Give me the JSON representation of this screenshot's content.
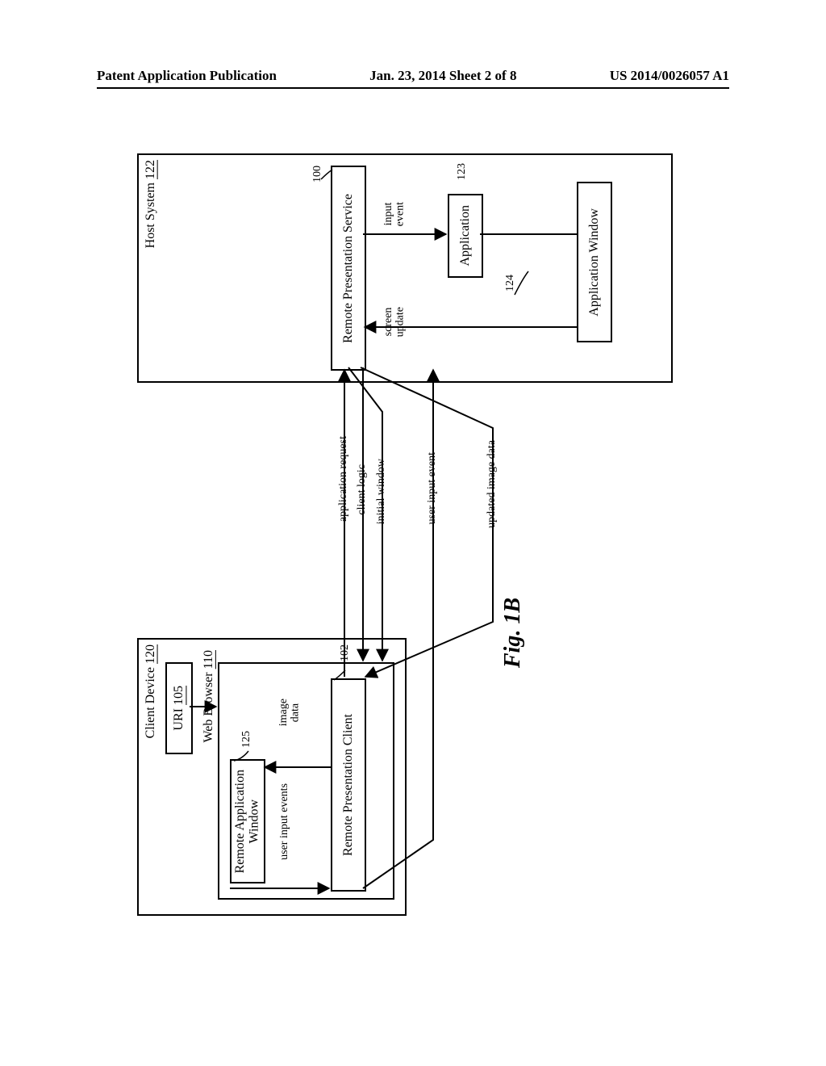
{
  "header": {
    "left": "Patent Application Publication",
    "center": "Jan. 23, 2014  Sheet 2 of 8",
    "right": "US 2014/0026057 A1"
  },
  "figure": {
    "caption": "Fig. 1B",
    "client_device": {
      "title": "Client Device",
      "ref": "120",
      "uri": {
        "label": "URI",
        "ref": "105"
      },
      "browser": {
        "label": "Web Browser",
        "ref": "110"
      },
      "remote_app_window": {
        "line1": "Remote Application",
        "line2": "Window",
        "ref": "125"
      },
      "rp_client": {
        "label": "Remote Presentation Client",
        "ref": "102"
      },
      "arrows": {
        "image_data": {
          "line1": "image",
          "line2": "data"
        },
        "user_input_events": "user input events"
      }
    },
    "host_system": {
      "title": "Host System",
      "ref": "122",
      "rp_service": {
        "label": "Remote Presentation Service",
        "ref": "100"
      },
      "application": {
        "label": "Application",
        "ref": "123"
      },
      "app_window": {
        "label": "Application Window",
        "ref": "124"
      },
      "arrows": {
        "input_event": {
          "line1": "input",
          "line2": "event"
        },
        "screen_update": {
          "line1": "screen",
          "line2": "update"
        }
      }
    },
    "between": {
      "application_request": "application request",
      "client_logic": "client logic",
      "initial_window": "initial window",
      "user_input_event": "user input event",
      "updated_image_data": "updated image data"
    }
  }
}
